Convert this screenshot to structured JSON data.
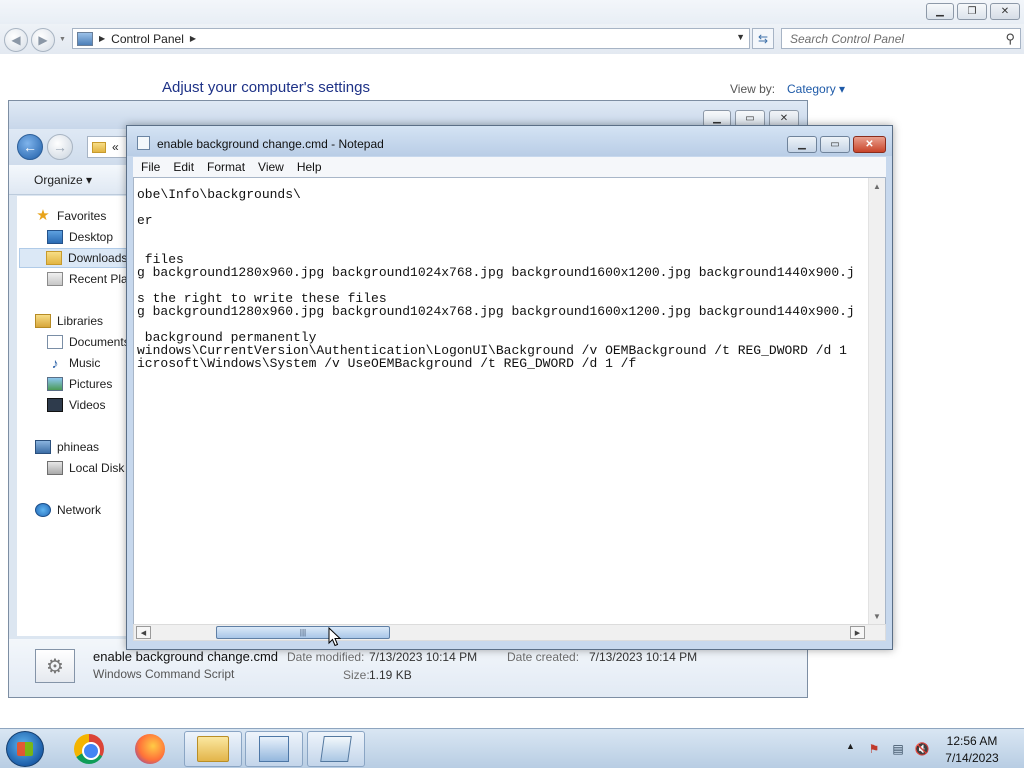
{
  "control_panel": {
    "address": "Control Panel",
    "search_placeholder": "Search Control Panel",
    "heading": "Adjust your computer's settings",
    "view_by_label": "View by:",
    "view_by_value": "Category ▾"
  },
  "explorer": {
    "address_chevrons": "«",
    "organize_label": "Organize ▾",
    "nav": {
      "favorites": "Favorites",
      "desktop": "Desktop",
      "downloads": "Downloads",
      "recent": "Recent Places",
      "libraries": "Libraries",
      "documents": "Documents",
      "music": "Music",
      "pictures": "Pictures",
      "videos": "Videos",
      "computer": "phineas",
      "local_disk": "Local Disk (C:)",
      "network": "Network"
    },
    "details": {
      "filename": "enable background change.cmd",
      "type": "Windows Command Script",
      "modified_label": "Date modified:",
      "modified_value": "7/13/2023 10:14 PM",
      "created_label": "Date created:",
      "created_value": "7/13/2023 10:14 PM",
      "size_label": "Size:",
      "size_value": "1.19 KB"
    }
  },
  "notepad": {
    "title": "enable background change.cmd - Notepad",
    "menu": [
      "File",
      "Edit",
      "Format",
      "View",
      "Help"
    ],
    "lines": [
      "obe\\Info\\backgrounds\\",
      "",
      "er",
      "",
      "",
      " files",
      "g background1280x960.jpg background1024x768.jpg background1600x1200.jpg background1440x900.j",
      "",
      "s the right to write these files",
      "g background1280x960.jpg background1024x768.jpg background1600x1200.jpg background1440x900.j",
      "",
      " background permanently",
      "windows\\CurrentVersion\\Authentication\\LogonUI\\Background /v OEMBackground /t REG_DWORD /d 1",
      "icrosoft\\Windows\\System /v UseOEMBackground /t REG_DWORD /d 1 /f"
    ],
    "hscroll_fraction": 0.1
  },
  "taskbar": {
    "apps": [
      "chrome-icon",
      "firefox-icon",
      "file-explorer-icon",
      "control-panel-icon",
      "notepad-icon"
    ],
    "time": "12:56 AM",
    "date": "7/14/2023"
  }
}
